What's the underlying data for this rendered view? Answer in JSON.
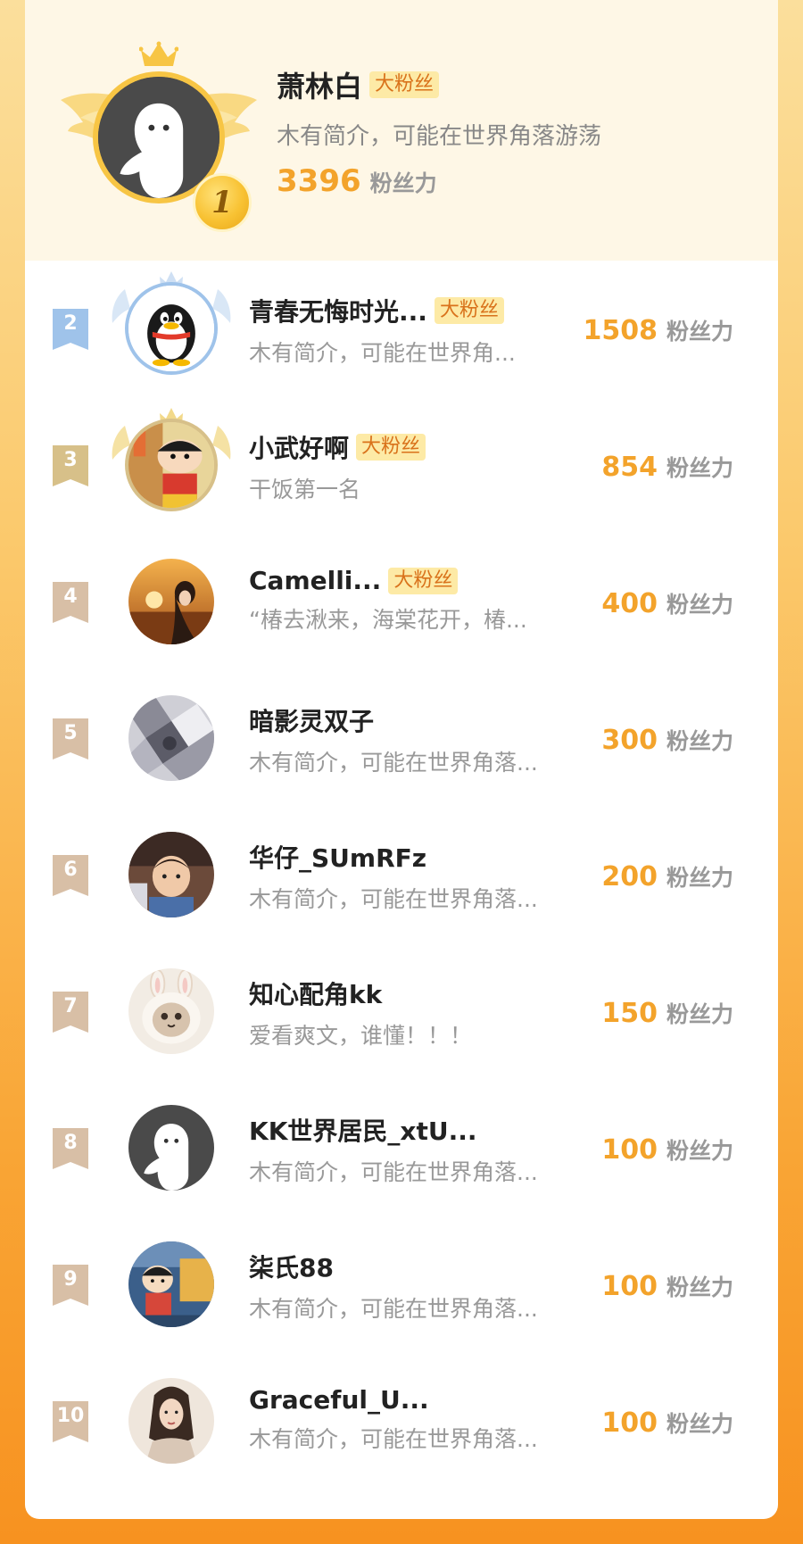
{
  "top": {
    "rank": "1",
    "name": "萧林白",
    "badge": "大粉丝",
    "bio": "木有简介，可能在世界角落游荡",
    "score": "3396",
    "unit": "粉丝力",
    "avatar": "default-ghost-avatar"
  },
  "rows": [
    {
      "rank": "2",
      "name": "青春无悔时光...",
      "badge": "大粉丝",
      "bio": "木有简介，可能在世界角...",
      "score": "1508",
      "unit": "粉丝力",
      "avatar": "penguin-avatar"
    },
    {
      "rank": "3",
      "name": "小武好啊",
      "badge": "大粉丝",
      "bio": "干饭第一名",
      "score": "854",
      "unit": "粉丝力",
      "avatar": "cartoon-boy-avatar"
    },
    {
      "rank": "4",
      "name": "Camelli...",
      "badge": "大粉丝",
      "bio": "“椿去湫来，海棠花开，椿...",
      "score": "400",
      "unit": "粉丝力",
      "avatar": "sunset-girl-avatar"
    },
    {
      "rank": "5",
      "name": "暗影灵双子",
      "badge": "",
      "bio": "木有简介，可能在世界角落...",
      "score": "300",
      "unit": "粉丝力",
      "avatar": "grey-pattern-avatar"
    },
    {
      "rank": "6",
      "name": "华仔_SUmRFz",
      "badge": "",
      "bio": "木有简介，可能在世界角落...",
      "score": "200",
      "unit": "粉丝力",
      "avatar": "baby-photo-avatar"
    },
    {
      "rank": "7",
      "name": "知心配角kk",
      "badge": "",
      "bio": "爱看爽文，谁懂！！！",
      "score": "150",
      "unit": "粉丝力",
      "avatar": "cat-bunny-avatar"
    },
    {
      "rank": "8",
      "name": "KK世界居民_xtU...",
      "badge": "",
      "bio": "木有简介，可能在世界角落...",
      "score": "100",
      "unit": "粉丝力",
      "avatar": "default-ghost-avatar"
    },
    {
      "rank": "9",
      "name": "柒氏88",
      "badge": "",
      "bio": "木有简介，可能在世界角落...",
      "score": "100",
      "unit": "粉丝力",
      "avatar": "cartoon-figure-avatar"
    },
    {
      "rank": "10",
      "name": "Graceful_U...",
      "badge": "",
      "bio": "木有简介，可能在世界角落...",
      "score": "100",
      "unit": "粉丝力",
      "avatar": "woman-portrait-avatar"
    }
  ],
  "colors": {
    "score": "#f3a32b",
    "badge_bg": "#fdeaa6",
    "badge_text": "#d9721b",
    "gold": "#f7c544",
    "silver": "#9fc3ea",
    "bronze": "#d7c089",
    "plain_rank": "#d8bfa6"
  }
}
